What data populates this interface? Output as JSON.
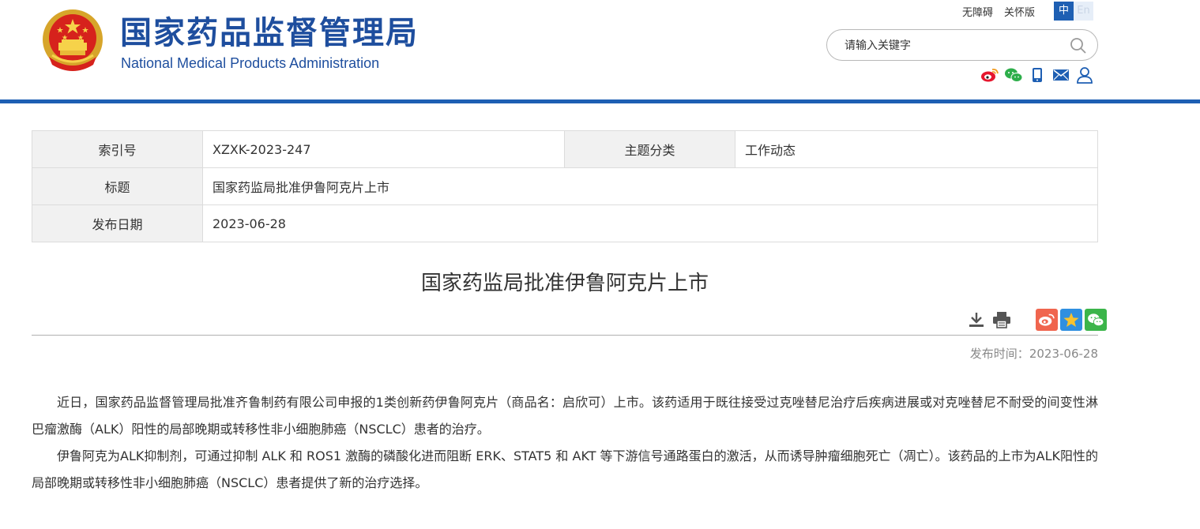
{
  "header": {
    "logo_cn": "国家药品监督管理局",
    "logo_en": "National Medical Products Administration",
    "top_links": [
      "无障碍",
      "关怀版"
    ],
    "lang_zh": "中",
    "lang_en": "En",
    "search_placeholder": "请输入关键字",
    "social_icons": [
      "weibo-icon",
      "wechat-icon",
      "mobile-icon",
      "mail-icon",
      "user-icon"
    ],
    "accent_color": "#1e5fb3"
  },
  "info": {
    "index_label": "索引号",
    "index_value": "XZXK-2023-247",
    "category_label": "主题分类",
    "category_value": "工作动态",
    "title_label": "标题",
    "title_value": "国家药监局批准伊鲁阿克片上市",
    "date_label": "发布日期",
    "date_value": "2023-06-28"
  },
  "article": {
    "title": "国家药监局批准伊鲁阿克片上市",
    "pub_label": "发布时间：",
    "pub_date": "2023-06-28",
    "paragraphs": [
      "近日，国家药品监督管理局批准齐鲁制药有限公司申报的1类创新药伊鲁阿克片（商品名：启欣可）上市。该药适用于既往接受过克唑替尼治疗后疾病进展或对克唑替尼不耐受的间变性淋巴瘤激酶（ALK）阳性的局部晚期或转移性非小细胞肺癌（NSCLC）患者的治疗。",
      "伊鲁阿克为ALK抑制剂，可通过抑制 ALK 和 ROS1 激酶的磷酸化进而阻断 ERK、STAT5 和 AKT 等下游信号通路蛋白的激活，从而诱导肿瘤细胞死亡（凋亡）。该药品的上市为ALK阳性的局部晚期或转移性非小细胞肺癌（NSCLC）患者提供了新的治疗选择。"
    ]
  }
}
